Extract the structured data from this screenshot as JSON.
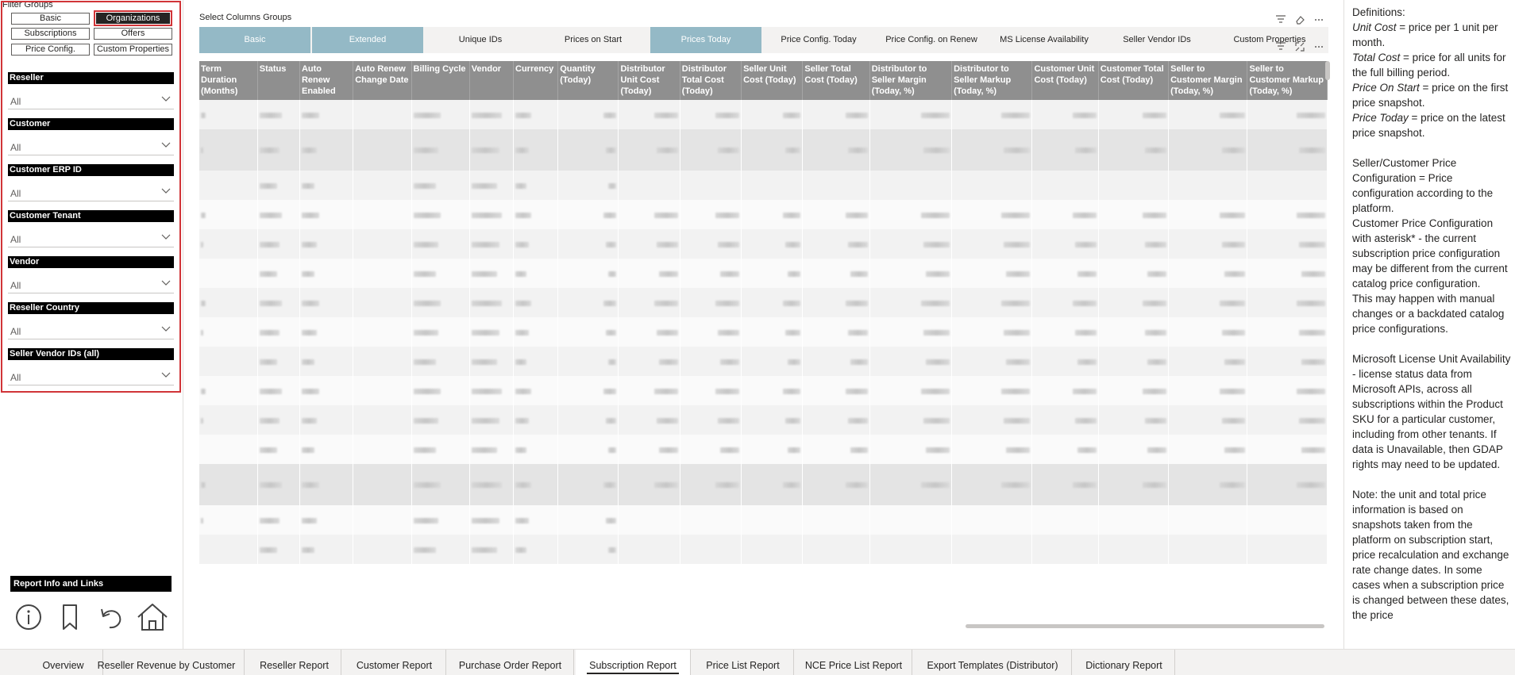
{
  "filter_panel": {
    "title": "Filter Groups",
    "group_buttons": [
      "Basic",
      "Organizations",
      "Subscriptions",
      "Offers",
      "Price Config.",
      "Custom Properties"
    ],
    "active_group": "Organizations",
    "slicers": [
      {
        "label": "Reseller",
        "value": "All"
      },
      {
        "label": "Customer",
        "value": "All"
      },
      {
        "label": "Customer ERP ID",
        "value": "All"
      },
      {
        "label": "Customer Tenant",
        "value": "All"
      },
      {
        "label": "Vendor",
        "value": "All"
      },
      {
        "label": "Reseller Country",
        "value": "All"
      },
      {
        "label": "Seller Vendor IDs (all)",
        "value": "All"
      }
    ],
    "info_title": "Report Info and Links",
    "info_icons": [
      "info-icon",
      "bookmark-icon",
      "back-arrow-icon",
      "home-icon"
    ]
  },
  "main": {
    "select_columns_title": "Select Columns Groups",
    "column_tabs": [
      "Basic",
      "Extended",
      "Unique IDs",
      "Prices on Start",
      "Prices Today",
      "Price Config. Today",
      "Price Config. on Renew",
      "MS License Availability",
      "Seller Vendor IDs",
      "Custom Properties"
    ],
    "active_column_tabs": [
      "Basic",
      "Extended",
      "Prices Today"
    ],
    "table_headers": [
      "Term Duration (Months)",
      "Status",
      "Auto Renew Enabled",
      "Auto Renew Change Date",
      "Billing Cycle",
      "Vendor",
      "Currency",
      "Quantity (Today)",
      "Distributor Unit Cost (Today)",
      "Distributor Total Cost (Today)",
      "Seller Unit Cost (Today)",
      "Seller Total Cost (Today)",
      "Distributor to Seller Margin (Today, %)",
      "Distributor to Seller Markup (Today, %)",
      "Customer Unit Cost (Today)",
      "Customer Total Cost (Today)",
      "Seller to Customer Margin (Today, %)",
      "Seller to Customer Markup (Today, %)"
    ],
    "row_count_visible": 15,
    "accent_color": "#94b9c6",
    "header_color": "#8f8f8f"
  },
  "definitions": {
    "heading": "Definitions:",
    "items": [
      {
        "term": "Unit Cost",
        "text": " = price per 1 unit per month."
      },
      {
        "term": "Total Cost",
        "text": " = price for all units for the full billing period."
      },
      {
        "term": "Price On Start",
        "text": " = price on the first price snapshot."
      },
      {
        "term": "Price Today",
        "text": " = price on the latest price snapshot."
      }
    ],
    "para_config": "Seller/Customer Price Configuration = Price configuration according to the platform.",
    "para_asterisk": "Customer Price Configuration with asterisk* - the current subscription price configuration may be different from the current catalog price configuration.",
    "para_manual": "This may happen with manual changes or a backdated catalog price configurations.",
    "para_ms": "Microsoft License Unit Availability - license status data from Microsoft APIs, across all subscriptions within the Product SKU for a particular customer, including from other tenants. If data is Unavailable, then GDAP rights may need to be updated.",
    "para_note": "Note: the unit and total price information is based on snapshots taken from the platform on subscription start, price recalculation and exchange rate change dates. In some cases when a subscription price is changed between these dates, the price"
  },
  "page_tabs": {
    "items": [
      "Overview",
      "Reseller Revenue by Customer",
      "Reseller Report",
      "Customer Report",
      "Purchase Order Report",
      "Subscription Report",
      "Price List Report",
      "NCE Price List Report",
      "Export Templates (Distributor)",
      "Dictionary Report"
    ],
    "active": "Subscription Report"
  }
}
